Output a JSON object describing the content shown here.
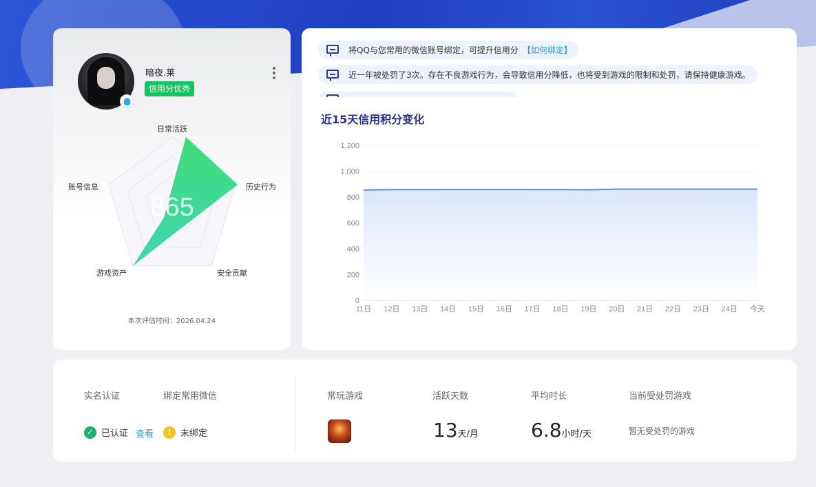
{
  "profile": {
    "nickname": "暗夜.莱",
    "credit_tag": "信用分优秀",
    "score": "865",
    "radar_labels": [
      "日常活跃",
      "历史行为",
      "安全贡献",
      "游戏资产",
      "账号信息"
    ],
    "eval_time": "本次评估时间：2026.04.24"
  },
  "notices": [
    {
      "text": "将QQ与您常用的微信账号绑定，可提升信用分",
      "link": "【如何绑定】"
    },
    {
      "text": "近一年被处罚了3次。存在不良游戏行为，会导致信用分降低，也将受到游戏的限制和处罚，请保持健康游戏。",
      "link": ""
    }
  ],
  "chart_title": "近15天信用积分变化",
  "chart_data": {
    "type": "area",
    "title": "近15天信用积分变化",
    "categories": [
      "11日",
      "12日",
      "13日",
      "14日",
      "15日",
      "16日",
      "17日",
      "18日",
      "19日",
      "20日",
      "21日",
      "22日",
      "23日",
      "24日",
      "今天"
    ],
    "series": [
      {
        "values": [
          855,
          857,
          857,
          857,
          857,
          857,
          857,
          857,
          856,
          861,
          861,
          861,
          861,
          861,
          861
        ]
      }
    ],
    "ylim": [
      0,
      1200
    ],
    "yticks": [
      "0",
      "200",
      "400",
      "600",
      "800",
      "1,000",
      "1,200"
    ],
    "grid": true,
    "color": "#5b8bd6",
    "fill": "#dde7fb"
  },
  "bottom": {
    "real_name_label": "实名认证",
    "wechat_label": "绑定常用微信",
    "real_name_status": "已认证",
    "view_link": "查看",
    "wechat_status": "未绑定",
    "game_label": "常玩游戏",
    "active_days_label": "活跃天数",
    "active_days_value": "13",
    "active_days_unit": "天/月",
    "avg_time_label": "平均时长",
    "avg_time_value": "6.8",
    "avg_time_unit": "小时/天",
    "punish_label": "当前受处罚游戏",
    "punish_value": "暂无受处罚的游戏"
  }
}
